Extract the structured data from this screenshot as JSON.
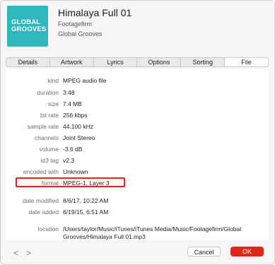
{
  "header": {
    "artwork_line1": "GLOBAL",
    "artwork_line2": "GROOVES",
    "artwork_color": "#2fb7bd",
    "title": "Himalaya Full 01",
    "artist": "Footagefirm",
    "album": "Global Grooves"
  },
  "tabs": [
    {
      "label": "Details",
      "active": false
    },
    {
      "label": "Artwork",
      "active": false
    },
    {
      "label": "Lyrics",
      "active": false
    },
    {
      "label": "Options",
      "active": false
    },
    {
      "label": "Sorting",
      "active": false
    },
    {
      "label": "File",
      "active": true
    }
  ],
  "fields": [
    {
      "label": "kind",
      "value": "MPEG audio file"
    },
    {
      "label": "duration",
      "value": "3:48"
    },
    {
      "label": "size",
      "value": "7.4 MB"
    },
    {
      "label": "bit rate",
      "value": "256 kbps"
    },
    {
      "label": "sample rate",
      "value": "44.100 kHz"
    },
    {
      "label": "channels",
      "value": "Joint Stereo"
    },
    {
      "label": "volume",
      "value": "-3.6 dB"
    },
    {
      "label": "id3 tag",
      "value": "v2.3"
    },
    {
      "label": "encoded with",
      "value": "Unknown"
    },
    {
      "label": "format",
      "value": "MPEG-1, Layer 3"
    },
    {
      "label": "date modified",
      "value": "8/6/17, 10:22 AM"
    },
    {
      "label": "date added",
      "value": "6/19/15, 6:51 AM"
    }
  ],
  "location": {
    "label": "location",
    "value": "/Users/taylor/Music/iTunes/iTunes Media/Music/Footagefirm/Global Grooves/Himalaya Full 01.mp3"
  },
  "footer": {
    "prev_glyph": "<",
    "next_glyph": ">",
    "cancel_label": "Cancel",
    "ok_label": "OK"
  },
  "colors": {
    "highlight_border": "#e0261c",
    "ok_button": "#e0261c"
  }
}
